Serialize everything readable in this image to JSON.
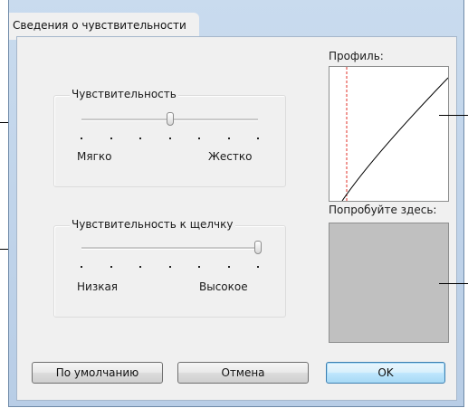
{
  "window": {
    "title": "Сведения о чувствительности"
  },
  "sensitivity": {
    "label": "Чувствительность",
    "min_label": "Мягко",
    "max_label": "Жестко",
    "value_fraction": 0.5,
    "tick_count": 7
  },
  "click_sensitivity": {
    "label": "Чувствительность к щелчку",
    "min_label": "Низкая",
    "max_label": "Высокое",
    "value_fraction": 1.0,
    "tick_count": 7
  },
  "profile": {
    "label": "Профиль:"
  },
  "try_here": {
    "label": "Попробуйте здесь:"
  },
  "buttons": {
    "default_label": "По умолчанию",
    "cancel_label": "Отмена",
    "ok_label": "OK"
  },
  "colors": {
    "profile_marker": "#e0302a",
    "try_area": "#c0c0c0",
    "ok_accent": "#3c7fb1"
  }
}
